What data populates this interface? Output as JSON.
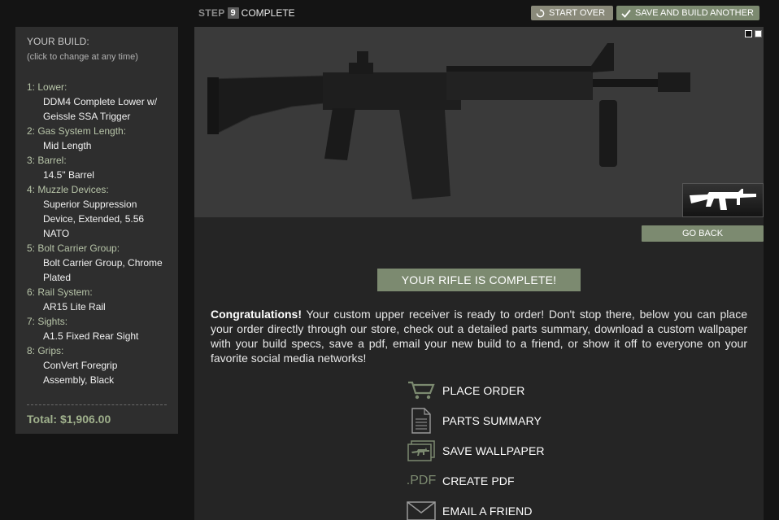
{
  "step": {
    "label": "STEP",
    "number": "9",
    "status": "COMPLETE"
  },
  "toolbar": {
    "start_over": "START OVER",
    "save_build": "SAVE AND BUILD ANOTHER"
  },
  "sidebar": {
    "title": "YOUR BUILD:",
    "subtitle": "(click to change at any time)",
    "items": [
      {
        "label": "1: Lower:",
        "value_lines": [
          "DDM4 Complete Lower w/",
          "Geissle SSA Trigger"
        ]
      },
      {
        "label": "2: Gas System Length:",
        "value_lines": [
          "Mid Length"
        ]
      },
      {
        "label": "3: Barrel:",
        "value_lines": [
          "14.5\" Barrel"
        ]
      },
      {
        "label": "4: Muzzle Devices:",
        "value_lines": [
          "Superior Suppression",
          "Device, Extended, 5.56",
          "NATO"
        ]
      },
      {
        "label": "5: Bolt Carrier Group:",
        "value_lines": [
          "Bolt Carrier Group, Chrome",
          "Plated"
        ]
      },
      {
        "label": "6: Rail System:",
        "value_lines": [
          "AR15 Lite Rail"
        ]
      },
      {
        "label": "7: Sights:",
        "value_lines": [
          "A1.5 Fixed Rear Sight"
        ]
      },
      {
        "label": "8: Grips:",
        "value_lines": [
          "ConVert Foregrip",
          "Assembly, Black"
        ]
      }
    ],
    "total": "Total: $1,906.00"
  },
  "viewer": {
    "go_back": "GO BACK"
  },
  "banner": "YOUR RIFLE IS COMPLETE!",
  "message": {
    "lead": "Congratulations!",
    "body": " Your custom upper receiver is ready to order! Don't stop there, below you can place your order directly through our store, check out a detailed parts summary, download a custom wallpaper with your build specs, save a pdf, email your new build to a friend, or show it off to everyone on your favorite social media networks!"
  },
  "actions": [
    {
      "icon": "cart-icon",
      "label": "PLACE ORDER"
    },
    {
      "icon": "document-icon",
      "label": "PARTS SUMMARY"
    },
    {
      "icon": "wallpaper-icon",
      "label": "SAVE WALLPAPER"
    },
    {
      "icon": "pdf-icon",
      "label": "CREATE PDF",
      "icon_text": ".PDF"
    },
    {
      "icon": "envelope-icon",
      "label": "EMAIL A FRIEND"
    }
  ],
  "colors": {
    "accent": "#7c8a70",
    "panel": "#252525",
    "sidebar": "#2e2e2e",
    "background": "#141414"
  }
}
